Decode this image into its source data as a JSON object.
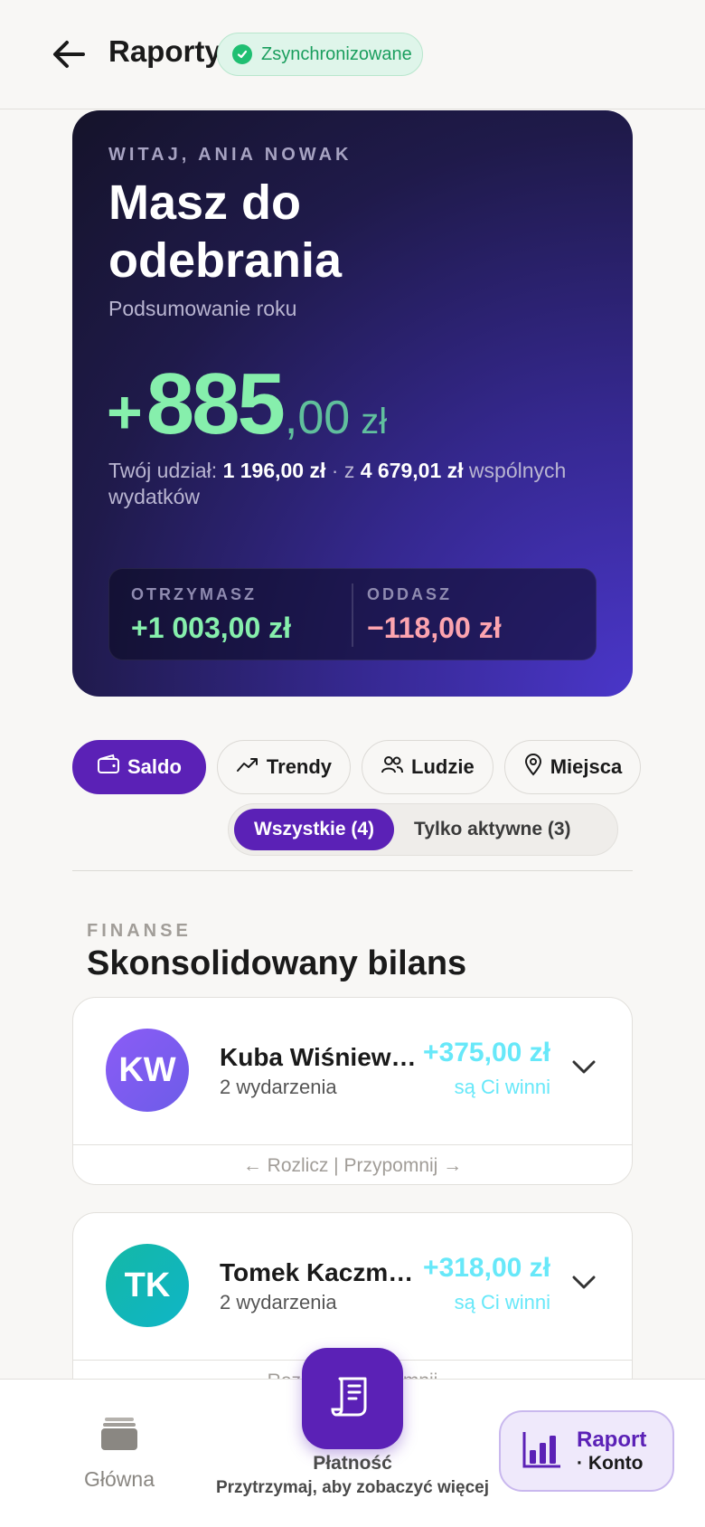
{
  "header": {
    "title": "Raporty",
    "sync_status": "Zsynchronizowane"
  },
  "hero": {
    "greeting": "WITAJ, ANIA NOWAK",
    "headline": "Masz do odebrania",
    "subtitle": "Podsumowanie roku",
    "amount_sign": "+",
    "amount_int": "885",
    "amount_dec": ",00",
    "amount_currency": "zł",
    "share_prefix": "Twój udział:",
    "share_value": "1 196,00 zł",
    "share_mid": "· z",
    "share_total": "4 679,01 zł",
    "share_suffix": "wspólnych wydatków",
    "receive_label": "OTRZYMASZ",
    "receive_value": "+1 003,00 zł",
    "give_label": "ODDASZ",
    "give_value": "−118,00 zł"
  },
  "tabs": [
    {
      "label": "Saldo",
      "icon": "wallet-icon",
      "active": true
    },
    {
      "label": "Trendy",
      "icon": "trend-icon",
      "active": false
    },
    {
      "label": "Ludzie",
      "icon": "people-icon",
      "active": false
    },
    {
      "label": "Miejsca",
      "icon": "pin-icon",
      "active": false
    }
  ],
  "filter": {
    "all": "Wszystkie (4)",
    "active_only": "Tylko aktywne (3)"
  },
  "section": {
    "kicker": "FINANSE",
    "title": "Skonsolidowany bilans"
  },
  "people": [
    {
      "initials": "KW",
      "name": "Kuba Wiśniewski",
      "events": "2 wydarzenia",
      "amount": "+375,00 zł",
      "status": "są Ci winni",
      "actions": "← Rozlicz | Przypomnij →",
      "color": "#7c5cf5"
    },
    {
      "initials": "TK",
      "name": "Tomek Kaczmarek",
      "events": "2 wydarzenia",
      "amount": "+318,00 zł",
      "status": "są Ci winni",
      "actions": "← Rozlicz | Przypomnij →",
      "color": "#14b8a6"
    }
  ],
  "bottom_nav": {
    "home": "Główna",
    "fab_label": "Płatność",
    "fab_hint": "Przytrzymaj, aby zobaczyć więcej",
    "report_title": "Raport",
    "report_sub": "· Konto"
  },
  "colors": {
    "accent": "#5b21b6",
    "positive": "#86efac",
    "negative": "#fda4af",
    "cyan": "#67e8f9"
  }
}
